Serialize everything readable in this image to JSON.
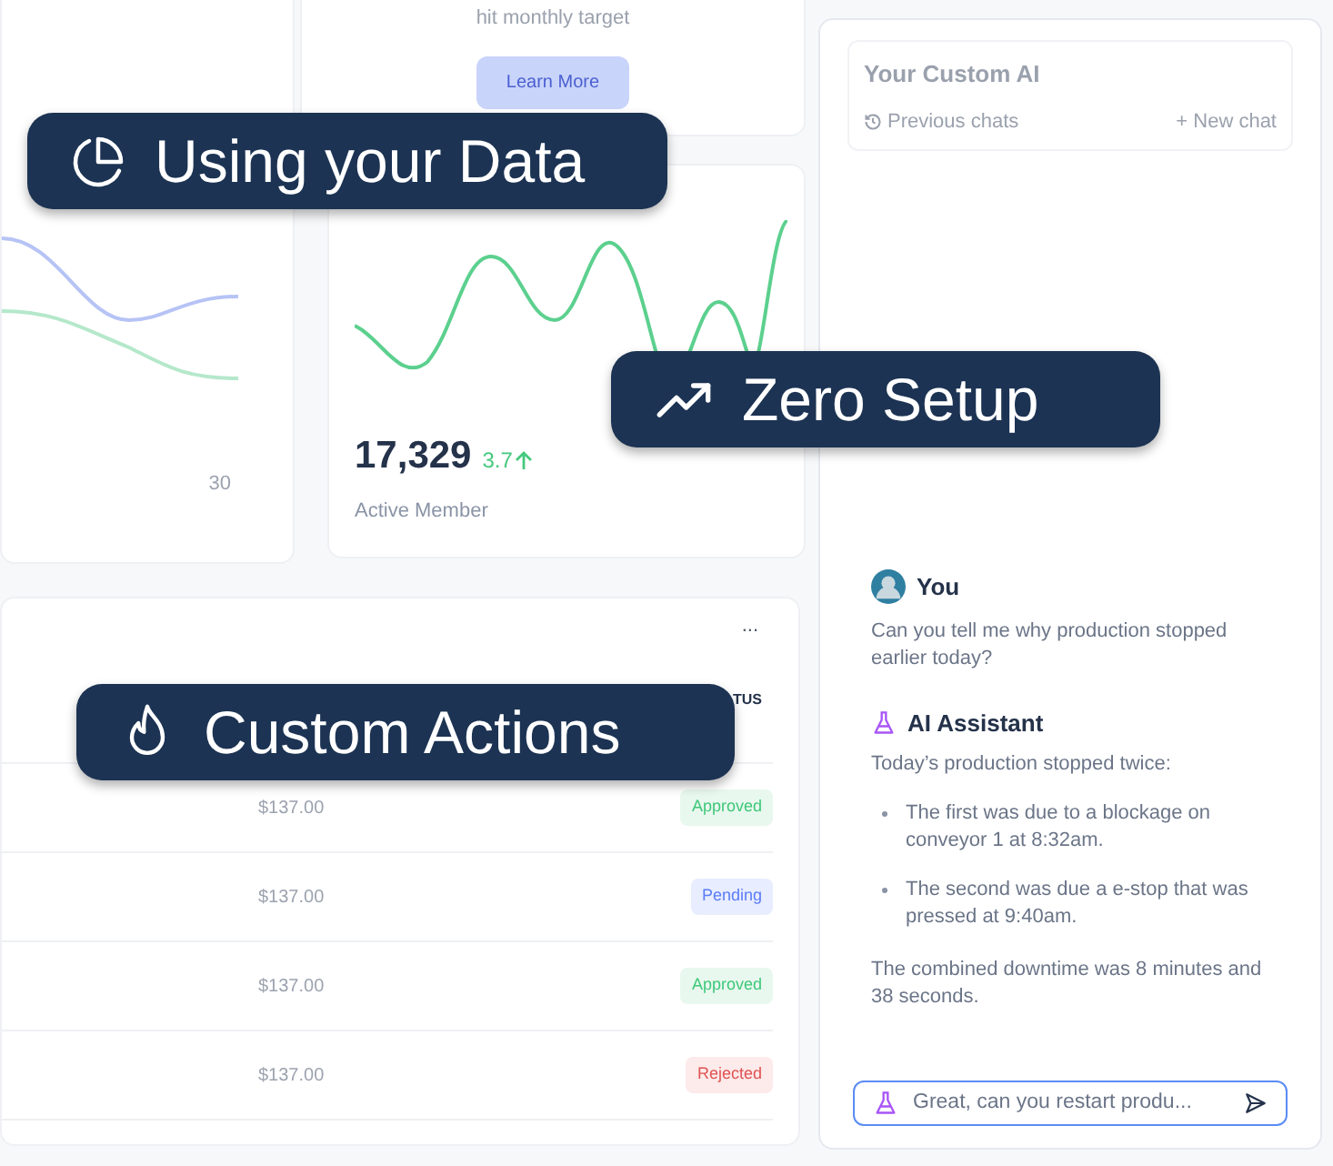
{
  "target_card": {
    "caption": "hit monthly target",
    "button": "Learn More"
  },
  "trend_card": {
    "axis_label": "30"
  },
  "stat_card": {
    "value": "17,329",
    "change": "3.7",
    "label": "Active Member"
  },
  "table": {
    "menu": "...",
    "columns": [
      "TUS"
    ],
    "rows": [
      {
        "amount": "$137.00",
        "status": "Approved",
        "kind": "approved"
      },
      {
        "amount": "$137.00",
        "status": "Pending",
        "kind": "pending"
      },
      {
        "amount": "$137.00",
        "status": "Approved",
        "kind": "approved"
      },
      {
        "amount": "$137.00",
        "status": "Rejected",
        "kind": "rejected"
      }
    ]
  },
  "chat": {
    "title": "Your Custom AI",
    "previous": "Previous chats",
    "new_chat": "+ New chat",
    "messages": [
      {
        "kind": "user",
        "author": "You",
        "paragraphs": [
          "Can you tell me why production stopped earlier today?"
        ]
      },
      {
        "kind": "assistant",
        "author": "AI Assistant",
        "paragraphs": [
          "Today’s production stopped twice:"
        ],
        "bullets": [
          "The first was due to a blockage on conveyor 1 at 8:32am.",
          "The second was due a e-stop that was pressed at 9:40am."
        ],
        "closing": "The combined downtime was 8 minutes and 38 seconds."
      }
    ],
    "input": "Great, can you restart produ..."
  },
  "callouts": [
    {
      "kind": "pie",
      "label": "Using your Data"
    },
    {
      "kind": "trend",
      "label": "Zero Setup"
    },
    {
      "kind": "flame",
      "label": "Custom Actions"
    }
  ]
}
